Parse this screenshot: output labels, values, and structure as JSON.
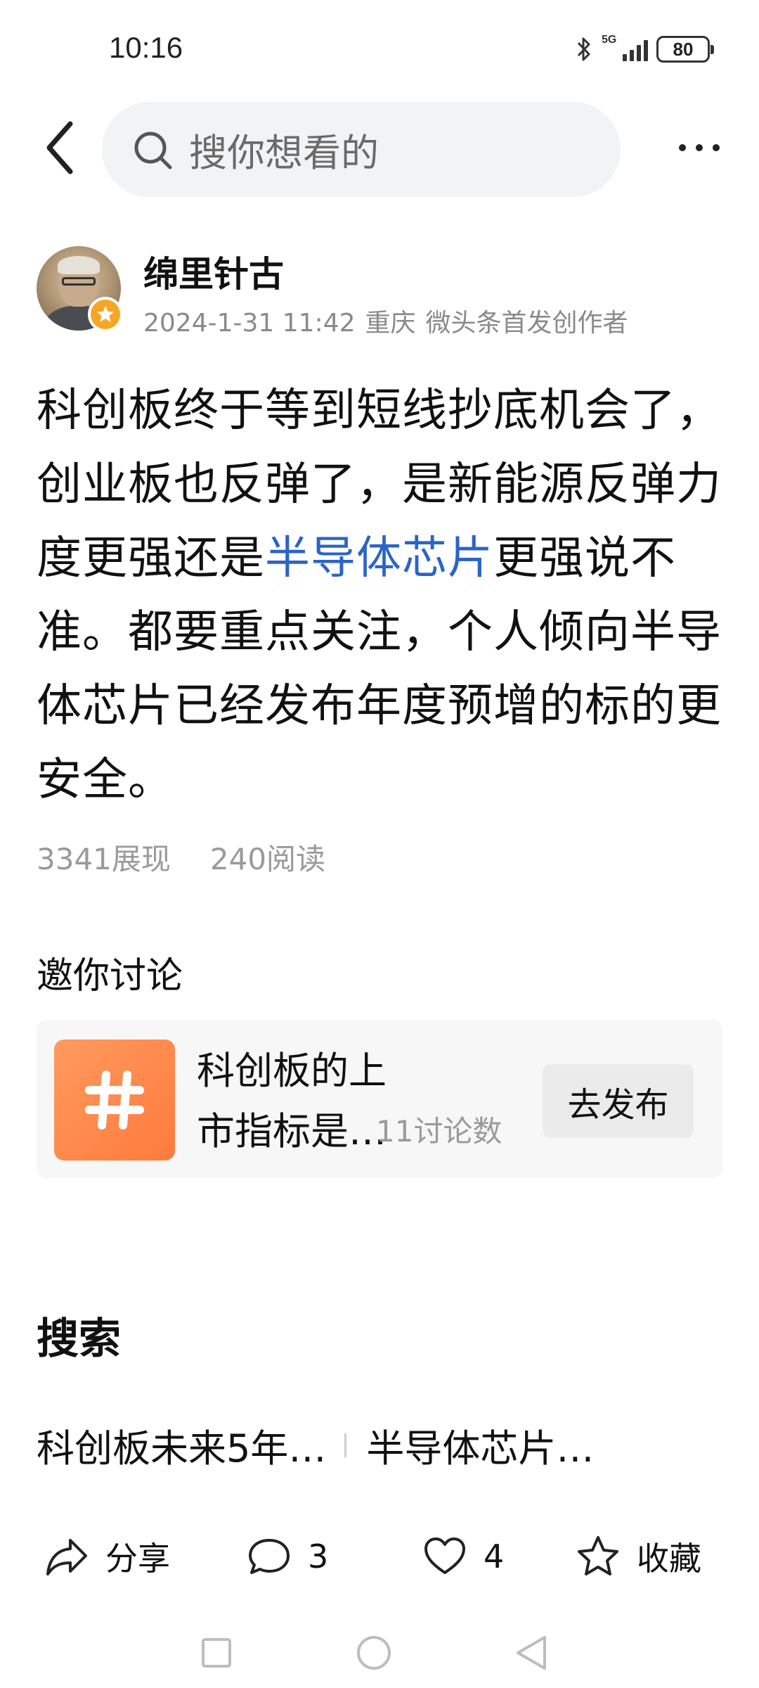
{
  "status_bar": {
    "time": "10:16",
    "network": "5G",
    "battery": "80"
  },
  "nav": {
    "search_placeholder": "搜你想看的"
  },
  "author": {
    "name": "绵里针古",
    "date": "2024-1-31 11:42",
    "location": "重庆",
    "tag": "微头条首发创作者"
  },
  "article": {
    "text_before": "科创板终于等到短线抄底机会了，创业板也反弹了，是新能源反弹力度更强还是",
    "highlight": "半导体芯片",
    "text_after": "更强说不准。都要重点关注，个人倾向半导体芯片已经发布年度预增的标的更安全。",
    "impressions": "3341展现",
    "reads": "240阅读"
  },
  "discussion": {
    "title": "邀你讨论",
    "topic": "科创板的上市指标是…",
    "count": "11讨论数",
    "button": "去发布"
  },
  "search": {
    "title": "搜索",
    "suggestions": [
      "科创板未来5年…",
      "半导体芯片…"
    ]
  },
  "actions": {
    "share": "分享",
    "comments": "3",
    "likes": "4",
    "favorite": "收藏"
  },
  "colors": {
    "highlight": "#2a64c8",
    "tag_orange": "#ff8a4c",
    "badge": "#f5a623"
  }
}
